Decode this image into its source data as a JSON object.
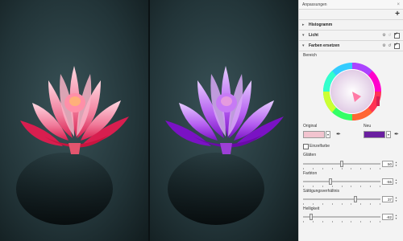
{
  "panel": {
    "title": "Anpassungen",
    "close": "×",
    "add": "+",
    "sections": [
      {
        "name": "Histogramm"
      },
      {
        "name": "Licht"
      },
      {
        "name": "Farben ersetzen"
      }
    ],
    "range_label": "Bereich",
    "original_label": "Original",
    "new_label": "Neu",
    "single_color_label": "Einzelfarbe",
    "sliders": [
      {
        "label": "Glätten",
        "value": "50",
        "level": 0.5
      },
      {
        "label": "Farbton",
        "value": "-55",
        "level": 0.35
      },
      {
        "label": "Sättigungsverhältnis",
        "value": "37",
        "level": 0.68
      },
      {
        "label": "Helligkeit",
        "value": "-82",
        "level": 0.09
      }
    ]
  },
  "colors": {
    "original_swatch": "#f2c4cf",
    "new_swatch": "#6a1fa0",
    "accent": "#d82052"
  }
}
